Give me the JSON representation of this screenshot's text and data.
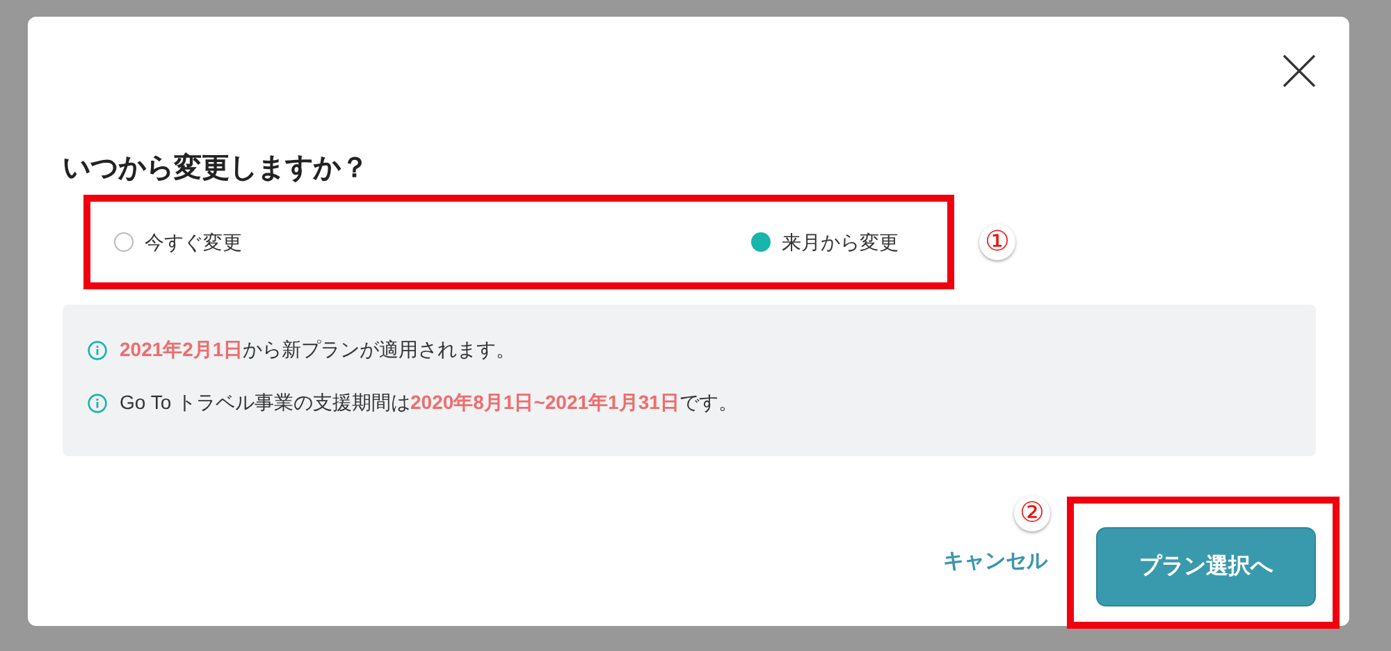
{
  "dialog": {
    "title": "いつから変更しますか？",
    "options": [
      {
        "label": "今すぐ変更",
        "selected": false
      },
      {
        "label": "来月から変更",
        "selected": true
      }
    ],
    "notes": [
      "**2021年2月1日**から新プランが適用されます。",
      "Go To トラベル事業の支援期間は**2020年8月1日~2021年1月31日**です。"
    ],
    "cancel": "キャンセル",
    "submit": "プラン選択へ"
  },
  "annotations": [
    {
      "label": "①"
    },
    {
      "label": "②"
    }
  ]
}
